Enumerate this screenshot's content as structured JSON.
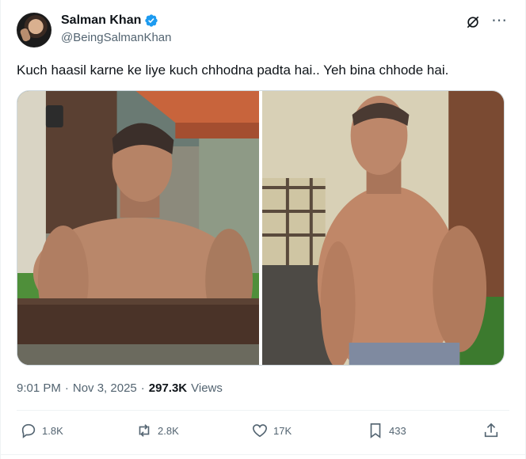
{
  "author": {
    "display_name": "Salman Khan",
    "handle": "@BeingSalmanKhan",
    "verified": true,
    "avatar_icon": "profile-avatar"
  },
  "tweet": {
    "text": "Kuch haasil karne ke liye kuch chhodna padta hai.. Yeh bina chhode hai."
  },
  "media": {
    "count": 2,
    "photos": [
      {
        "icon": "photo-shirtless-man-leaning-on-railing"
      },
      {
        "icon": "photo-shirtless-man-standing-hand-on-hip"
      }
    ]
  },
  "meta": {
    "time": "9:01 PM",
    "date": "Nov 3, 2025",
    "views_count": "297.3K",
    "views_label": "Views",
    "separator": "·"
  },
  "actions": {
    "reply_count": "1.8K",
    "repost_count": "2.8K",
    "like_count": "17K",
    "bookmark_count": "433"
  },
  "icons": {
    "verified": "verified-badge-icon",
    "grok": "grok-icon",
    "more": "more-icon",
    "reply": "reply-icon",
    "repost": "repost-icon",
    "like": "like-icon",
    "bookmark": "bookmark-icon",
    "share": "share-icon"
  },
  "colors": {
    "text_primary": "#0f1419",
    "text_secondary": "#536471",
    "verified_blue": "#1d9bf0",
    "border": "#cfd9de"
  }
}
